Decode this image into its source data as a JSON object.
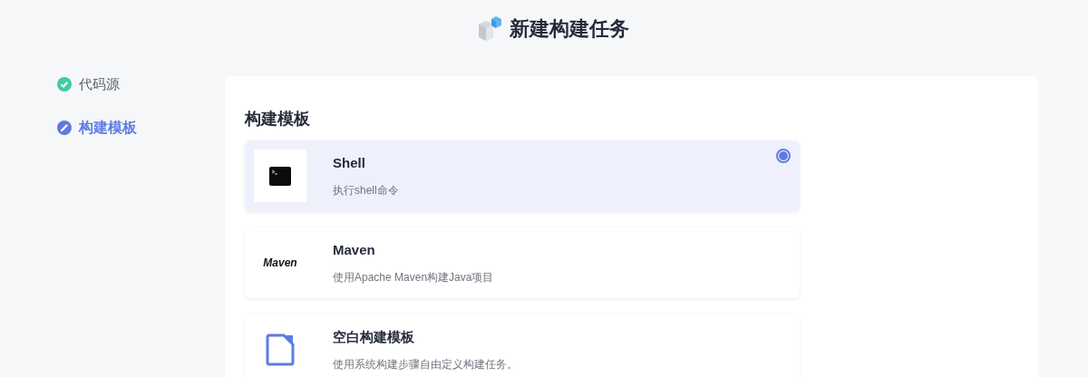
{
  "page_title": "新建构建任务",
  "steps": [
    {
      "label": "代码源",
      "completed": true
    },
    {
      "label": "构建模板",
      "completed": false
    }
  ],
  "section_title": "构建模板",
  "templates": [
    {
      "kind": "shell",
      "name": "Shell",
      "description": "执行shell命令",
      "selected": true
    },
    {
      "kind": "maven",
      "name": "Maven",
      "logo_text": "Maven",
      "description": "使用Apache Maven构建Java项目",
      "selected": false
    },
    {
      "kind": "blank",
      "name": "空白构建模板",
      "description": "使用系统构建步骤自由定义构建任务。",
      "selected": false
    }
  ]
}
